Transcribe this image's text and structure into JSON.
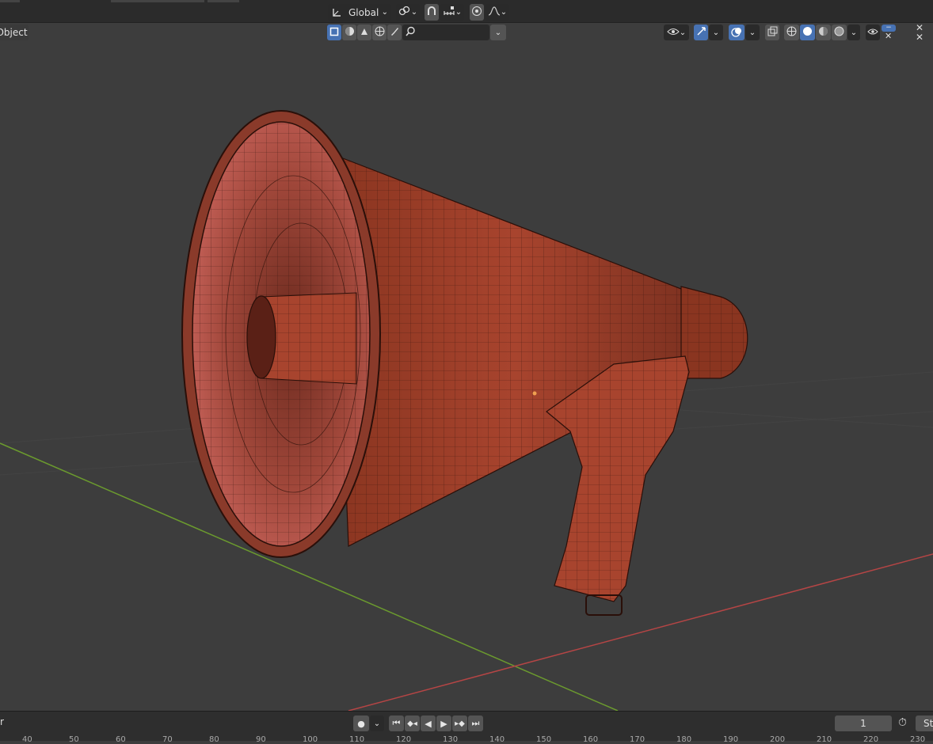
{
  "header": {
    "transform_orientation": "Global",
    "mode_label": "Object",
    "search_placeholder": ""
  },
  "viewport": {
    "object": "megaphone-mesh",
    "axis_colors": {
      "x": "#b54545",
      "y": "#6b9a2e"
    },
    "mesh_color": "#a8442e"
  },
  "timeline": {
    "left_label": "r",
    "current_frame": "1",
    "start_label": "St",
    "ruler_ticks": [
      "40",
      "50",
      "60",
      "70",
      "80",
      "90",
      "100",
      "110",
      "120",
      "130",
      "140",
      "150",
      "160",
      "170",
      "180",
      "190",
      "200",
      "210",
      "220",
      "230"
    ]
  },
  "icons": {
    "transform": "transform-orientation-icon",
    "pivot": "pivot-icon",
    "snap": "snap-icon",
    "proportional": "proportional-edit-icon",
    "select_box": "select-box-icon",
    "visibility": "visibility-icon",
    "gizmo": "gizmo-icon",
    "overlay": "overlay-icon",
    "xray": "xray-icon",
    "shading_wire": "wireframe-shading-icon",
    "shading_solid": "solid-shading-icon",
    "shading_material": "material-shading-icon",
    "shading_render": "rendered-shading-icon"
  }
}
